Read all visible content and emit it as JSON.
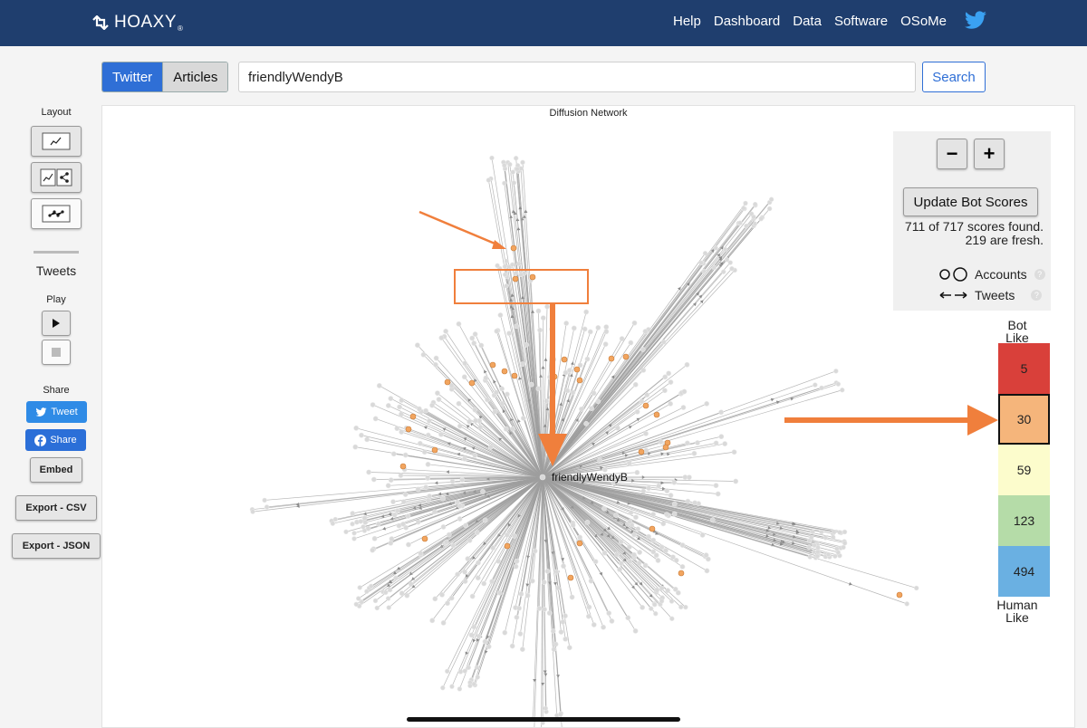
{
  "navbar": {
    "brand": "HOAXY",
    "brand_mark": "®",
    "links": [
      "Help",
      "Dashboard",
      "Data",
      "Software",
      "OSoMe"
    ],
    "twitter_icon": "twitter-bird-icon"
  },
  "search": {
    "tabs": [
      {
        "label": "Twitter",
        "active": true
      },
      {
        "label": "Articles",
        "active": false
      }
    ],
    "query": "friendlyWendyB",
    "button": "Search"
  },
  "sidebar": {
    "layout_label": "Layout",
    "tweets_label": "Tweets",
    "play_label": "Play",
    "share_label": "Share",
    "tweet_btn": "Tweet",
    "share_btn": "Share",
    "embed_btn": "Embed",
    "export_csv": "Export - CSV",
    "export_json": "Export - JSON"
  },
  "graph": {
    "title": "Diffusion Network",
    "center_label": "friendlyWendyB",
    "colors": {
      "edge": "#9e9e9e",
      "node": "#d9d9d9",
      "bot_node": "#f2a55f",
      "annotation": "#f07f3c"
    }
  },
  "controls": {
    "zoom_out": "−",
    "zoom_in": "+",
    "update_btn": "Update Bot Scores",
    "scores_found": "711 of 717 scores found.",
    "scores_fresh": "219 are fresh.",
    "legend_accounts": "Accounts",
    "legend_tweets": "Tweets",
    "help_mark": "?"
  },
  "bot_scale": {
    "top_label_1": "Bot",
    "top_label_2": "Like",
    "bottom_label_1": "Human",
    "bottom_label_2": "Like",
    "bins": [
      {
        "count": "5",
        "color": "#d9403a"
      },
      {
        "count": "30",
        "color": "#f5b57b",
        "selected": true
      },
      {
        "count": "59",
        "color": "#fcfccc"
      },
      {
        "count": "123",
        "color": "#b5dca8"
      },
      {
        "count": "494",
        "color": "#6ab0e2"
      }
    ]
  }
}
